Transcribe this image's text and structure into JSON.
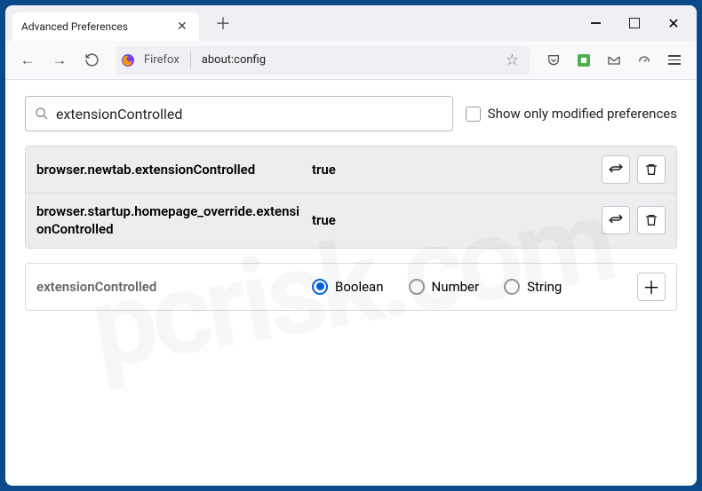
{
  "window": {
    "tab_title": "Advanced Preferences"
  },
  "urlbar": {
    "identity_label": "Firefox",
    "url": "about:config"
  },
  "search": {
    "value": "extensionControlled",
    "show_only_label": "Show only modified preferences"
  },
  "prefs": [
    {
      "key": "browser.newtab.extensionControlled",
      "value": "true"
    },
    {
      "key": "browser.startup.homepage_override.extensionControlled",
      "value": "true"
    }
  ],
  "new_pref": {
    "key": "extensionControlled",
    "type_options": {
      "boolean": "Boolean",
      "number": "Number",
      "string": "String"
    },
    "selected": "boolean"
  }
}
